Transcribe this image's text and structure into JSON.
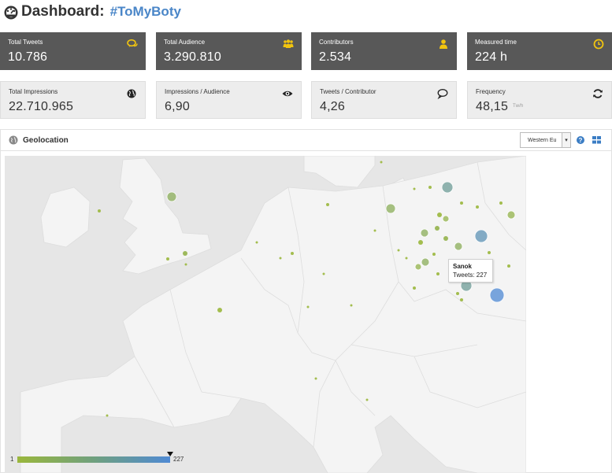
{
  "header": {
    "title": "Dashboard:",
    "hashtag": "#ToMyBoty"
  },
  "stats_top": [
    {
      "label": "Total Tweets",
      "value": "10.786",
      "icon": "chat-bubbles-icon"
    },
    {
      "label": "Total Audience",
      "value": "3.290.810",
      "icon": "users-icon"
    },
    {
      "label": "Contributors",
      "value": "2.534",
      "icon": "user-icon"
    },
    {
      "label": "Measured time",
      "value": "224 h",
      "icon": "clock-icon"
    }
  ],
  "stats_bottom": [
    {
      "label": "Total Impressions",
      "value": "22.710.965",
      "icon": "globe-icon"
    },
    {
      "label": "Impressions / Audience",
      "value": "6,90",
      "icon": "eye-icon"
    },
    {
      "label": "Tweets / Contributor",
      "value": "4,26",
      "icon": "speech-bubble-icon"
    },
    {
      "label": "Frequency",
      "value": "48,15",
      "unit": "Tw/h",
      "icon": "refresh-icon"
    }
  ],
  "geolocation": {
    "title": "Geolocation",
    "region_selected": "Western Eu",
    "tooltip": {
      "name": "Sanok",
      "value": "Tweets: 227"
    },
    "legend": {
      "min": "1",
      "max": "227"
    }
  },
  "colors": {
    "accent": "#4a86c8",
    "card_dark": "#585858",
    "card_light": "#ededed",
    "icon_yellow": "#f1c40f",
    "bubble_low": "#9ab73c",
    "bubble_high": "#4f8ad4",
    "land": "#f4f4f4",
    "sea": "#e6e6e6"
  }
}
